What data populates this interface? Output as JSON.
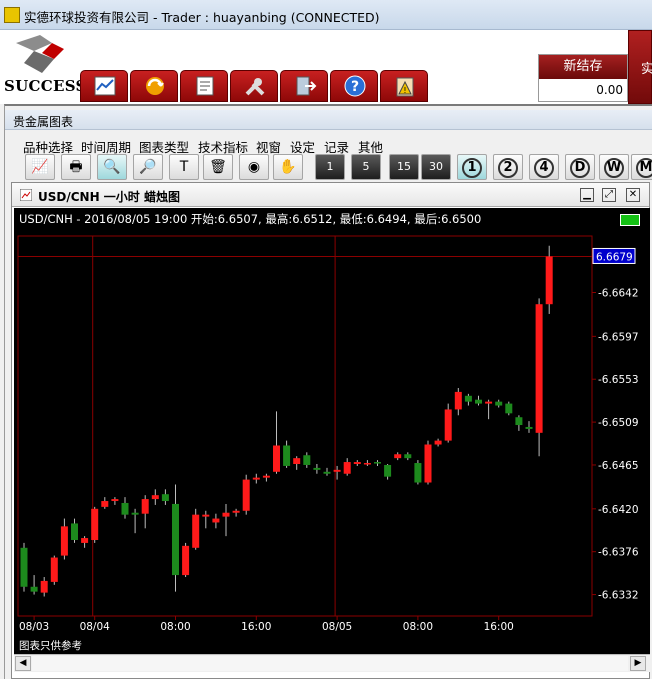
{
  "window": {
    "title": "实德环球投资有限公司 -  Trader : huayanbing (CONNECTED)"
  },
  "logo": {
    "text": "SUCCESS"
  },
  "toolbar_icons": [
    "chart-icon",
    "refresh-icon",
    "notes-icon",
    "tools-icon",
    "exit-icon",
    "help-icon",
    "clipboard-alert-icon"
  ],
  "panels": {
    "new_margin_label": "新结存",
    "new_margin_value": "0.00",
    "edge_label": "实"
  },
  "subwindow": {
    "title": "贵金属图表"
  },
  "menu": [
    "品种选择",
    "时间周期",
    "图表类型",
    "技术指标",
    "视窗",
    "设定",
    "记录",
    "其他"
  ],
  "tool_buttons": [
    "line-chart-icon",
    "print-icon",
    "zoom-in-icon",
    "zoom-out-icon",
    "text-tool-icon",
    "delete-icon",
    "record-icon",
    "clear-icon"
  ],
  "period_buttons": [
    "1",
    "5",
    "15",
    "30",
    "1",
    "2",
    "4",
    "D",
    "W",
    "M"
  ],
  "chart_window": {
    "title": "USD/CNH 一小时 蜡烛图"
  },
  "ohlc_header": "USD/CNH - 2016/08/05 19:00 开始:6.6507, 最高:6.6512, 最低:6.6494, 最后:6.6500",
  "footer_note": "图表只供参考",
  "colors": {
    "up": "#ff1a1a",
    "down": "#1d8a1d",
    "grid": "#8b0000",
    "background": "#000000",
    "last_price_bg": "#0000cc"
  },
  "chart_data": {
    "type": "candlestick",
    "ylim": [
      6.631,
      6.67
    ],
    "y_ticks": [
      6.6332,
      6.6376,
      6.642,
      6.6465,
      6.6509,
      6.6553,
      6.6597,
      6.6642
    ],
    "last_price": 6.6679,
    "x_ticks": [
      {
        "index": 1,
        "label": "08/03"
      },
      {
        "index": 7,
        "label": "08/04"
      },
      {
        "index": 15,
        "label": "08:00"
      },
      {
        "index": 23,
        "label": "16:00"
      },
      {
        "index": 31,
        "label": "08/05"
      },
      {
        "index": 39,
        "label": "08:00"
      },
      {
        "index": 47,
        "label": "16:00"
      }
    ],
    "candles": [
      {
        "o": 6.638,
        "h": 6.6385,
        "l": 6.6335,
        "c": 6.634
      },
      {
        "o": 6.634,
        "h": 6.6352,
        "l": 6.6332,
        "c": 6.6335
      },
      {
        "o": 6.6334,
        "h": 6.635,
        "l": 6.633,
        "c": 6.6346
      },
      {
        "o": 6.6345,
        "h": 6.6372,
        "l": 6.6342,
        "c": 6.637
      },
      {
        "o": 6.6372,
        "h": 6.641,
        "l": 6.6368,
        "c": 6.6402
      },
      {
        "o": 6.6405,
        "h": 6.641,
        "l": 6.6385,
        "c": 6.6388
      },
      {
        "o": 6.6385,
        "h": 6.6392,
        "l": 6.638,
        "c": 6.639
      },
      {
        "o": 6.6388,
        "h": 6.6422,
        "l": 6.6385,
        "c": 6.642
      },
      {
        "o": 6.6422,
        "h": 6.6432,
        "l": 6.642,
        "c": 6.6428
      },
      {
        "o": 6.6428,
        "h": 6.6432,
        "l": 6.6424,
        "c": 6.643
      },
      {
        "o": 6.6426,
        "h": 6.6432,
        "l": 6.641,
        "c": 6.6414
      },
      {
        "o": 6.6416,
        "h": 6.642,
        "l": 6.6395,
        "c": 6.6414
      },
      {
        "o": 6.6415,
        "h": 6.6434,
        "l": 6.64,
        "c": 6.643
      },
      {
        "o": 6.643,
        "h": 6.644,
        "l": 6.6424,
        "c": 6.6434
      },
      {
        "o": 6.6435,
        "h": 6.644,
        "l": 6.6424,
        "c": 6.6428
      },
      {
        "o": 6.6425,
        "h": 6.6445,
        "l": 6.6335,
        "c": 6.6352
      },
      {
        "o": 6.6352,
        "h": 6.6385,
        "l": 6.635,
        "c": 6.6382
      },
      {
        "o": 6.638,
        "h": 6.642,
        "l": 6.6378,
        "c": 6.6414
      },
      {
        "o": 6.6412,
        "h": 6.6418,
        "l": 6.64,
        "c": 6.6414
      },
      {
        "o": 6.6406,
        "h": 6.6415,
        "l": 6.64,
        "c": 6.641
      },
      {
        "o": 6.6412,
        "h": 6.6425,
        "l": 6.6392,
        "c": 6.6416
      },
      {
        "o": 6.6416,
        "h": 6.642,
        "l": 6.6412,
        "c": 6.6418
      },
      {
        "o": 6.6418,
        "h": 6.6455,
        "l": 6.6414,
        "c": 6.645
      },
      {
        "o": 6.645,
        "h": 6.6456,
        "l": 6.6446,
        "c": 6.6452
      },
      {
        "o": 6.6452,
        "h": 6.6456,
        "l": 6.6448,
        "c": 6.6454
      },
      {
        "o": 6.6458,
        "h": 6.652,
        "l": 6.6456,
        "c": 6.6485
      },
      {
        "o": 6.6485,
        "h": 6.649,
        "l": 6.6462,
        "c": 6.6464
      },
      {
        "o": 6.6466,
        "h": 6.6474,
        "l": 6.646,
        "c": 6.6472
      },
      {
        "o": 6.6475,
        "h": 6.6478,
        "l": 6.6462,
        "c": 6.6465
      },
      {
        "o": 6.6462,
        "h": 6.6466,
        "l": 6.6456,
        "c": 6.646
      },
      {
        "o": 6.6458,
        "h": 6.6462,
        "l": 6.6454,
        "c": 6.6456
      },
      {
        "o": 6.6458,
        "h": 6.6464,
        "l": 6.645,
        "c": 6.646
      },
      {
        "o": 6.6456,
        "h": 6.6472,
        "l": 6.6454,
        "c": 6.6468
      },
      {
        "o": 6.6466,
        "h": 6.647,
        "l": 6.6464,
        "c": 6.6468
      },
      {
        "o": 6.6466,
        "h": 6.647,
        "l": 6.6464,
        "c": 6.6467
      },
      {
        "o": 6.6468,
        "h": 6.647,
        "l": 6.6464,
        "c": 6.6467
      },
      {
        "o": 6.6465,
        "h": 6.6466,
        "l": 6.645,
        "c": 6.6453
      },
      {
        "o": 6.6472,
        "h": 6.6478,
        "l": 6.647,
        "c": 6.6476
      },
      {
        "o": 6.6476,
        "h": 6.6478,
        "l": 6.647,
        "c": 6.6472
      },
      {
        "o": 6.6467,
        "h": 6.647,
        "l": 6.6445,
        "c": 6.6447
      },
      {
        "o": 6.6447,
        "h": 6.649,
        "l": 6.6445,
        "c": 6.6486
      },
      {
        "o": 6.6486,
        "h": 6.6492,
        "l": 6.6484,
        "c": 6.649
      },
      {
        "o": 6.649,
        "h": 6.6528,
        "l": 6.6488,
        "c": 6.6522
      },
      {
        "o": 6.6522,
        "h": 6.6544,
        "l": 6.6516,
        "c": 6.654
      },
      {
        "o": 6.6536,
        "h": 6.6538,
        "l": 6.6526,
        "c": 6.653
      },
      {
        "o": 6.6532,
        "h": 6.6536,
        "l": 6.6526,
        "c": 6.6528
      },
      {
        "o": 6.6528,
        "h": 6.6532,
        "l": 6.6512,
        "c": 6.653
      },
      {
        "o": 6.653,
        "h": 6.6532,
        "l": 6.6524,
        "c": 6.6526
      },
      {
        "o": 6.6528,
        "h": 6.653,
        "l": 6.6516,
        "c": 6.6518
      },
      {
        "o": 6.6514,
        "h": 6.6516,
        "l": 6.65,
        "c": 6.6506
      },
      {
        "o": 6.6504,
        "h": 6.651,
        "l": 6.6498,
        "c": 6.6502
      },
      {
        "o": 6.6498,
        "h": 6.6636,
        "l": 6.6474,
        "c": 6.663
      },
      {
        "o": 6.663,
        "h": 6.669,
        "l": 6.662,
        "c": 6.6679
      }
    ]
  }
}
